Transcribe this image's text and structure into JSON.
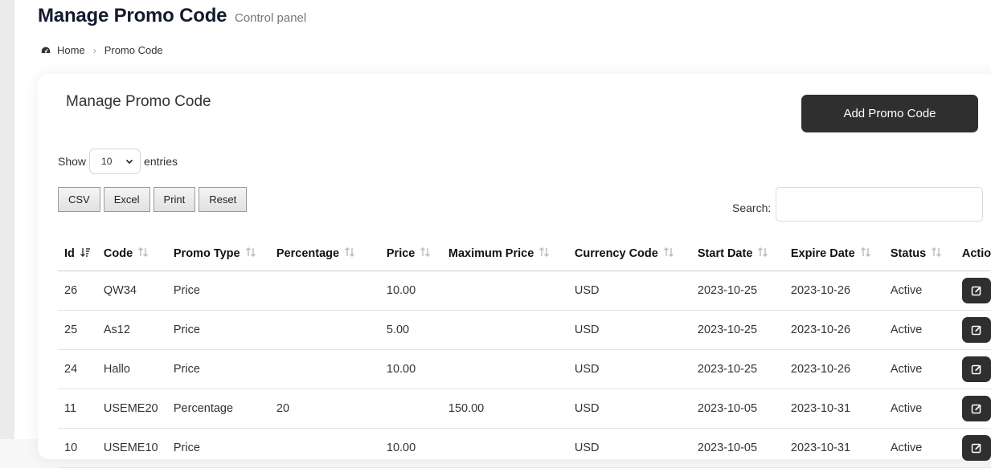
{
  "header": {
    "title": "Manage Promo Code",
    "subtitle": "Control panel"
  },
  "breadcrumb": {
    "home": "Home",
    "current": "Promo Code"
  },
  "card": {
    "title": "Manage Promo Code",
    "add_button": "Add Promo Code"
  },
  "length": {
    "show_label": "Show",
    "value": "10",
    "entries_label": "entries"
  },
  "buttons": {
    "csv": "CSV",
    "excel": "Excel",
    "print": "Print",
    "reset": "Reset"
  },
  "search": {
    "label": "Search:",
    "value": ""
  },
  "table": {
    "headers": [
      "Id",
      "Code",
      "Promo Type",
      "Percentage",
      "Price",
      "Maximum Price",
      "Currency Code",
      "Start Date",
      "Expire Date",
      "Status",
      "Actio"
    ],
    "rows": [
      [
        "26",
        "QW34",
        "Price",
        "",
        "10.00",
        "",
        "USD",
        "2023-10-25",
        "2023-10-26",
        "Active"
      ],
      [
        "25",
        "As12",
        "Price",
        "",
        "5.00",
        "",
        "USD",
        "2023-10-25",
        "2023-10-26",
        "Active"
      ],
      [
        "24",
        "Hallo",
        "Price",
        "",
        "10.00",
        "",
        "USD",
        "2023-10-25",
        "2023-10-26",
        "Active"
      ],
      [
        "11",
        "USEME20",
        "Percentage",
        "20",
        "",
        "150.00",
        "USD",
        "2023-10-05",
        "2023-10-31",
        "Active"
      ],
      [
        "10",
        "USEME10",
        "Price",
        "",
        "10.00",
        "",
        "USD",
        "2023-10-05",
        "2023-10-31",
        "Active"
      ]
    ]
  },
  "colors": {
    "dark_button": "#2f2f2f",
    "title": "#141a2e"
  }
}
